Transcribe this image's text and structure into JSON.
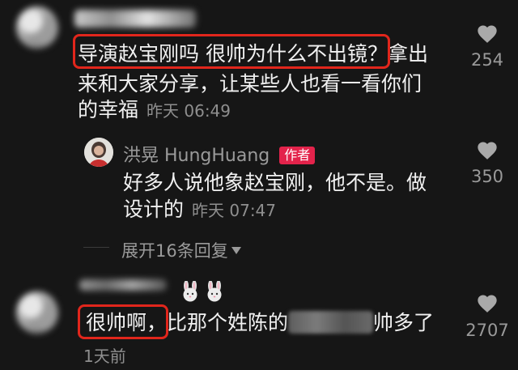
{
  "comments": [
    {
      "user": "",
      "text_lines": [
        "导演赵宝刚吗 很帅为什么不出镜？拿出",
        "来和大家分享，让某些人也看一看你们",
        "的幸福"
      ],
      "time": "昨天 06:49",
      "likes": "254",
      "reply": {
        "user": "洪晃 HungHuang",
        "badge": "作者",
        "text_lines": [
          "好多人说他象赵宝刚，他不是。做",
          "设计的"
        ],
        "time": "昨天 07:47",
        "likes": "350"
      },
      "expand_label": "展开16条回复"
    },
    {
      "user": "",
      "text_prefix": "很帅啊，比那个姓陈的",
      "text_suffix": "帅多了",
      "time": "1天前",
      "likes": "2707"
    }
  ],
  "colors": {
    "background": "#161616",
    "highlight_box": "#e1261c",
    "author_badge": "#e3234b"
  },
  "icons": {
    "like": "heart-icon",
    "expand": "caret-down-icon",
    "emoji": "rabbit-emoji"
  }
}
